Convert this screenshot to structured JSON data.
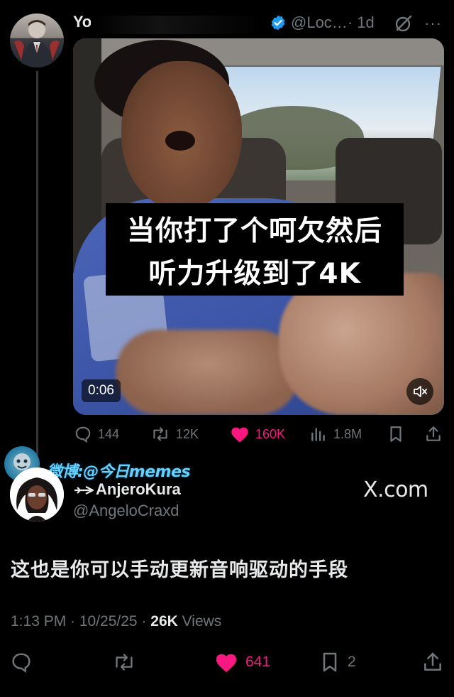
{
  "parent_tweet": {
    "name_visible": "Yo",
    "handle": "@Loc…",
    "time": "· 1d",
    "more_label": "···",
    "media": {
      "caption_line1": "当你打了个呵欠然后",
      "caption_line2": "听力升级到了4K",
      "duration": "0:06"
    },
    "stats": {
      "replies": "144",
      "reposts": "12K",
      "likes": "160K",
      "views": "1.8M"
    }
  },
  "watermark": {
    "text": "微博:@今日memes"
  },
  "reply": {
    "name": "AnjeroKura",
    "handle": "@AngeloCraxd",
    "brand": "X.com",
    "text": "这也是你可以手动更新音响驱动的手段",
    "meta": {
      "time": "1:13 PM · 10/25/25 · ",
      "views_count": "26K",
      "views_label": " Views"
    },
    "actions": {
      "likes": "641",
      "bookmarks": "2"
    }
  },
  "colors": {
    "like": "#f91880",
    "muted": "#71767b",
    "verified": "#1d9bf0",
    "background": "#000000"
  }
}
